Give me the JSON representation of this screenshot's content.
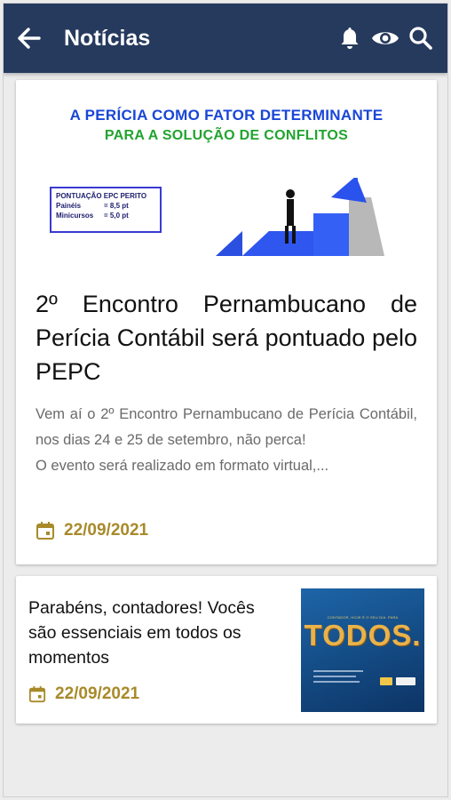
{
  "appbar": {
    "title": "Notícias",
    "actions": [
      "bell-icon",
      "eye-icon",
      "search-icon"
    ]
  },
  "colors": {
    "appbar": "#263a5e",
    "date": "#a88a2a",
    "banner_blue": "#1946d8",
    "banner_green": "#22a32f"
  },
  "articles": [
    {
      "banner": {
        "line1": "A PERÍCIA COMO FATOR DETERMINANTE",
        "line2": "PARA A SOLUÇÃO DE CONFLITOS",
        "box_title": "PONTUAÇÃO EPC PERITO",
        "box_row1_label": "Painéis",
        "box_row1_value": "= 8,5 pt",
        "box_row2_label": "Minicursos",
        "box_row2_value": "= 5,0 pt"
      },
      "title": "2º Encontro Pernambucano de Perícia Contábil será pontuado pelo PEPC",
      "excerpt_p1": "Vem aí o 2º Encontro Pernambucano de Perícia Contábil, nos dias 24 e 25 de setembro, não perca!",
      "excerpt_p2": "O evento será realizado em formato virtual,...",
      "date": "22/09/2021"
    },
    {
      "title": "Parabéns, contadores! Vocês são essenciais em todos os momentos",
      "thumb_small": "CONTADOR, HOJE É O SEU DIA. PARA",
      "thumb_big": "TODOS.",
      "date": "22/09/2021"
    }
  ]
}
